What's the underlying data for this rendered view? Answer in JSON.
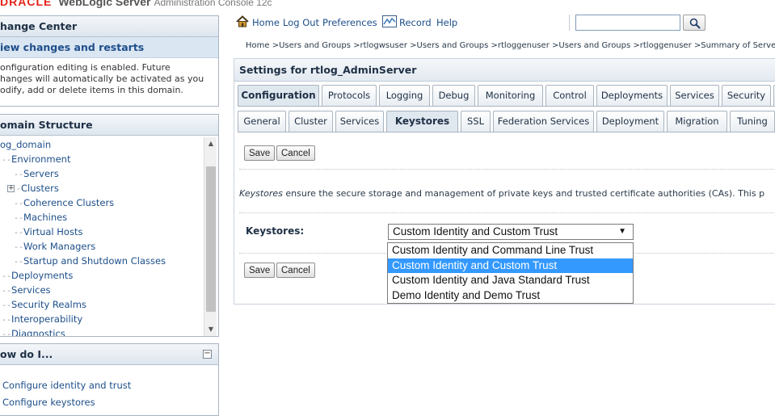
{
  "brand": {
    "logo": "DRACLE",
    "product": "WebLogic Server",
    "subtitle": "Administration Console 12c"
  },
  "change_center": {
    "title": "hange Center",
    "view_changes": "iew changes and restarts",
    "text": "onfiguration editing is enabled. Future\nhanges will automatically be activated as you\nodify, add or delete items in this domain."
  },
  "domain_structure": {
    "title": "omain Structure",
    "tree": [
      {
        "label": "og_domain",
        "conn": ""
      },
      {
        "label": "Environment",
        "conn": "⎯"
      },
      {
        "label": "Servers",
        "conn": "⎯"
      },
      {
        "label": "Clusters",
        "conn": "⎯",
        "expandable": true
      },
      {
        "label": "Coherence Clusters",
        "conn": "⎯"
      },
      {
        "label": "Machines",
        "conn": "⎯"
      },
      {
        "label": "Virtual Hosts",
        "conn": "⎯"
      },
      {
        "label": "Work Managers",
        "conn": "⎯"
      },
      {
        "label": "Startup and Shutdown Classes",
        "conn": "⎯"
      },
      {
        "label": "Deployments",
        "conn": "⎯"
      },
      {
        "label": "Services",
        "conn": "⎯"
      },
      {
        "label": "Security Realms",
        "conn": "⎯"
      },
      {
        "label": "Interoperability",
        "conn": "⎯"
      },
      {
        "label": "Diagnostics",
        "conn": "⎯"
      }
    ]
  },
  "how_do_i": {
    "title": "ow do I...",
    "links": [
      "Configure identity and trust",
      "Configure keystores"
    ]
  },
  "toolbar": {
    "home": "Home",
    "logout": "Log Out",
    "preferences": "Preferences",
    "record": "Record",
    "help": "Help",
    "search_value": ""
  },
  "breadcrumb": "Home >Users and Groups >rtlogwsuser >Users and Groups >rtloggenuser >Users and Groups >rtloggenuser >Summary of Serve",
  "settings": {
    "title": "Settings for rtlog_AdminServer",
    "main_tabs": [
      "Configuration",
      "Protocols",
      "Logging",
      "Debug",
      "Monitoring",
      "Control",
      "Deployments",
      "Services",
      "Security",
      ""
    ],
    "sub_tabs": [
      "General",
      "Cluster",
      "Services",
      "Keystores",
      "SSL",
      "Federation Services",
      "Deployment",
      "Migration",
      "Tuning",
      ""
    ],
    "save_label": "Save",
    "cancel_label": "Cancel",
    "description_em": "Keystores",
    "description_rest": " ensure the secure storage and management of private keys and trusted certificate authorities (CAs). This p",
    "keystores_label": "Keystores:",
    "keystores_selected": "Custom Identity and Custom Trust",
    "keystores_options": [
      "Custom Identity and Command Line Trust",
      "Custom Identity and Custom Trust",
      "Custom Identity and Java Standard Trust",
      "Demo Identity and Demo Trust"
    ],
    "keystores_selected_index": 1
  },
  "colors": {
    "link": "#1d4f8a",
    "panel_header": "#dde5ee",
    "selection": "#3399ff",
    "brand_red": "#e2231a"
  }
}
